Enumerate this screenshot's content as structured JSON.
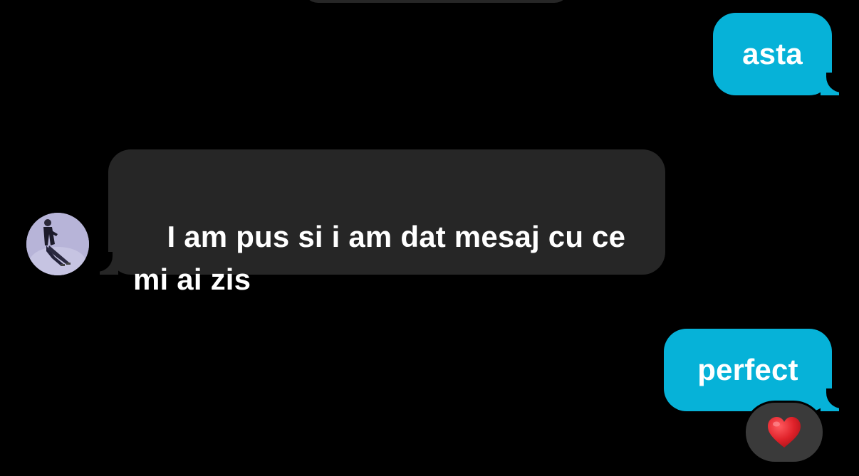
{
  "messages": [
    {
      "id": "m1",
      "direction": "outgoing",
      "text": "asta"
    },
    {
      "id": "m2",
      "direction": "incoming",
      "text": "I am pus si i am dat mesaj cu ce\nmi ai zis"
    },
    {
      "id": "m3",
      "direction": "outgoing",
      "text": "perfect",
      "reaction": "heart-emoji"
    }
  ],
  "colors": {
    "background": "#000000",
    "outgoing_bubble": "#06b2d8",
    "incoming_bubble": "#262626",
    "reaction_pill": "#3a3a3a",
    "heart": "#e0222a"
  },
  "icons": {
    "avatar": "contact-avatar-photo",
    "reaction": "heart-emoji"
  }
}
